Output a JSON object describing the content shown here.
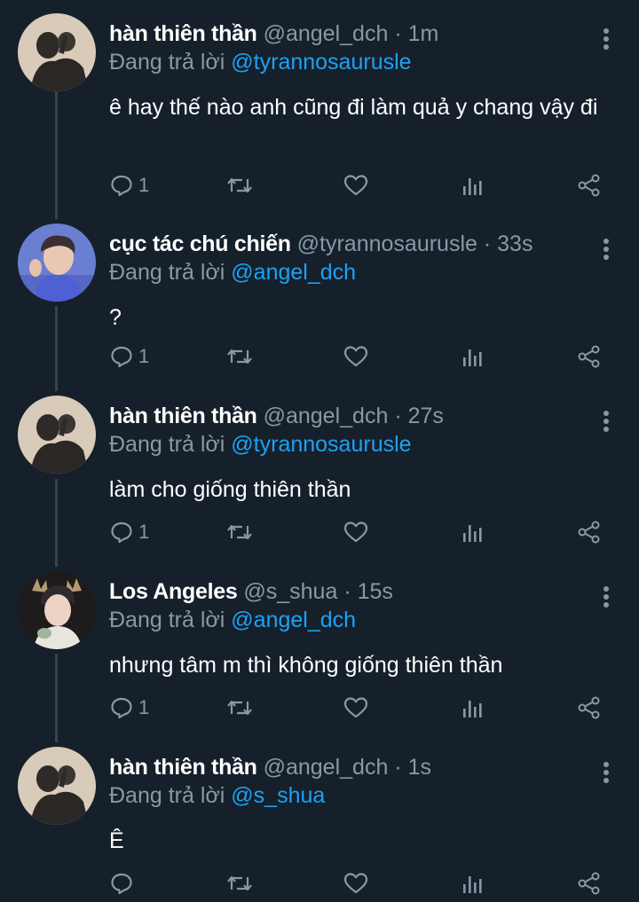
{
  "colors": {
    "background": "#15202b",
    "secondary_text": "#8899a6",
    "mention": "#1da1f2",
    "thread_line": "#38444d"
  },
  "replying_prefix": "Đang trả lời",
  "tweets": [
    {
      "name": "hàn thiên thần",
      "handle": "@angel_dch",
      "time": "1m",
      "reply_to": "@tyrannosaurusle",
      "text": "ê hay thế nào anh cũng đi làm quả y chang vậy đi",
      "replies": "1",
      "icons": [
        "reply-icon",
        "retweet-icon",
        "like-icon",
        "analytics-icon",
        "share-icon",
        "more-icon"
      ]
    },
    {
      "name": "cục tác chú chiến",
      "handle": "@tyrannosaurusle",
      "time": "33s",
      "reply_to": "@angel_dch",
      "text": "?",
      "replies": "1"
    },
    {
      "name": "hàn thiên thần",
      "handle": "@angel_dch",
      "time": "27s",
      "reply_to": "@tyrannosaurusle",
      "text": "làm cho giống thiên thần",
      "replies": "1"
    },
    {
      "name": "Los Angeles",
      "handle": "@s_shua",
      "time": "15s",
      "reply_to": "@angel_dch",
      "text": "nhưng tâm m thì không giống thiên thần",
      "replies": "1"
    },
    {
      "name": "hàn thiên thần",
      "handle": "@angel_dch",
      "time": "1s",
      "reply_to": "@s_shua",
      "text": "Ê",
      "replies": ""
    }
  ]
}
